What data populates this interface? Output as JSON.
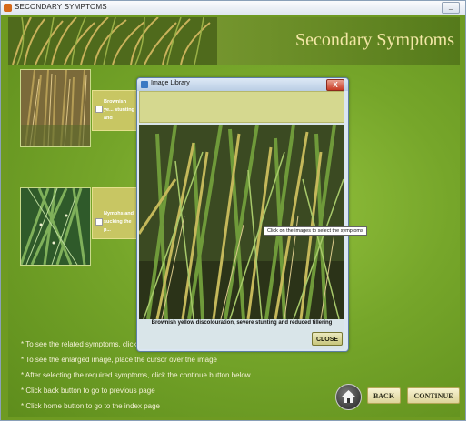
{
  "window": {
    "title": "SECONDARY SYMPTOMS",
    "minimize_glyph": "_"
  },
  "banner": {
    "heading": "Secondary Symptoms"
  },
  "symptoms": [
    {
      "label": "Brownish ye... stunting and",
      "checked": false
    },
    {
      "label": "Nymphs and sucking the p...",
      "checked": false
    }
  ],
  "dialog": {
    "title": "Image Library",
    "close_glyph": "X",
    "caption": "Brownish yellow discolouration, severe stunting and reduced tillering",
    "close_button": "CLOSE"
  },
  "tooltip": "Click on the images to select the symptoms",
  "instructions": [
    "* To see the related symptoms, click",
    "* To see the enlarged image, place the cursor over the image",
    "* After selecting the required symptoms, click the continue button below",
    "* Click back button to go to previous page",
    "* Click home button to go to the index page"
  ],
  "nav": {
    "back": "BACK",
    "continue": "CONTINUE"
  },
  "icons": {
    "app": "app-icon",
    "home": "home-icon",
    "dialog": "image-library-icon"
  },
  "colors": {
    "background_green": "#76a62a",
    "heading_cream": "#f3e7a6",
    "label_box": "#c8c663",
    "dialog_close_red": "#c73a23"
  }
}
